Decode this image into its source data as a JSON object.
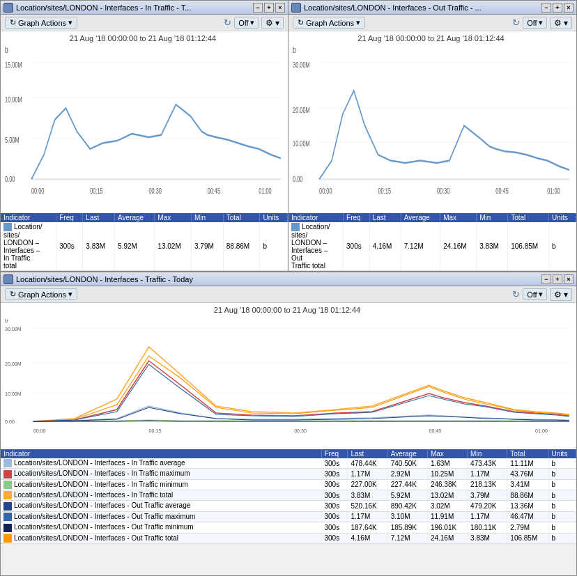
{
  "panels": {
    "top_left": {
      "title": "Location/sites/LONDON - Interfaces - In Traffic - T...",
      "time_range": "21 Aug '18 00:00:00 to 21 Aug '18 01:12:44",
      "y_label": "b",
      "y_ticks": [
        "15.00M",
        "10.00M",
        "5.00M",
        "0.00"
      ],
      "x_ticks": [
        "00:00",
        "00:15",
        "00:30",
        "00:45",
        "01:00"
      ],
      "graph_actions": "Graph Actions",
      "off_label": "Off",
      "table": {
        "headers": [
          "Indicator",
          "Freq",
          "Last",
          "Average",
          "Max",
          "Min",
          "Total",
          "Units"
        ],
        "rows": [
          {
            "color": "#6699cc",
            "name": "Location/\nsites/\nLONDON –\nInterfaces –\nIn Traffic\ntotal",
            "freq": "300s",
            "last": "3.83M",
            "average": "5.92M",
            "max": "13.02M",
            "min": "3.79M",
            "total": "88.86M",
            "units": "b"
          }
        ]
      }
    },
    "top_right": {
      "title": "Location/sites/LONDON - Interfaces - Out Traffic - ...",
      "time_range": "21 Aug '18 00:00:00 to 21 Aug '18 01:12:44",
      "y_label": "b",
      "y_ticks": [
        "30.00M",
        "20.00M",
        "10.00M",
        "0.00"
      ],
      "x_ticks": [
        "00:00",
        "00:15",
        "00:30",
        "00:45",
        "01:00"
      ],
      "graph_actions": "Graph Actions",
      "off_label": "Off",
      "table": {
        "headers": [
          "Indicator",
          "Freq",
          "Last",
          "Average",
          "Max",
          "Min",
          "Total",
          "Units"
        ],
        "rows": [
          {
            "color": "#6699cc",
            "name": "Location/\nsites/\nLONDON –\nInterfaces –\nOut\nTraffic total",
            "freq": "300s",
            "last": "4.16M",
            "average": "7.12M",
            "max": "24.16M",
            "min": "3.83M",
            "total": "106.85M",
            "units": "b"
          }
        ]
      }
    },
    "bottom": {
      "title": "Location/sites/LONDON - Interfaces - Traffic - Today",
      "time_range": "21 Aug '18 00:00:00 to 21 Aug '18 01:12:44",
      "y_label": "b",
      "y_ticks": [
        "30.00M",
        "20.00M",
        "10.00M",
        "0.00"
      ],
      "x_ticks": [
        "00:00",
        "00:15",
        "00:30",
        "00:45",
        "01:00"
      ],
      "graph_actions": "Graph Actions",
      "off_label": "Off",
      "table": {
        "headers": [
          "Indicator",
          "Freq",
          "Last",
          "Average",
          "Max",
          "Min",
          "Total",
          "Units"
        ],
        "rows": [
          {
            "color": "#99bbdd",
            "name": "Location/sites/LONDON - Interfaces - In Traffic average",
            "freq": "300s",
            "last": "478.44K",
            "average": "740.50K",
            "max": "1.63M",
            "min": "473.43K",
            "total": "11.11M",
            "units": "b"
          },
          {
            "color": "#cc4444",
            "name": "Location/sites/LONDON - Interfaces - In Traffic maximum",
            "freq": "300s",
            "last": "1.17M",
            "average": "2.92M",
            "max": "10.25M",
            "min": "1.17M",
            "total": "43.76M",
            "units": "b"
          },
          {
            "color": "#88cc88",
            "name": "Location/sites/LONDON - Interfaces - In Traffic minimum",
            "freq": "300s",
            "last": "227.00K",
            "average": "227.44K",
            "max": "246.38K",
            "min": "218.13K",
            "total": "3.41M",
            "units": "b"
          },
          {
            "color": "#ffaa33",
            "name": "Location/sites/LONDON - Interfaces - In Traffic total",
            "freq": "300s",
            "last": "3.83M",
            "average": "5.92M",
            "max": "13.02M",
            "min": "3.79M",
            "total": "88.86M",
            "units": "b"
          },
          {
            "color": "#224488",
            "name": "Location/sites/LONDON - Interfaces - Out Traffic average",
            "freq": "300s",
            "last": "520.16K",
            "average": "890.42K",
            "max": "3.02M",
            "min": "479.20K",
            "total": "13.36M",
            "units": "b"
          },
          {
            "color": "#3366aa",
            "name": "Location/sites/LONDON - Interfaces - Out Traffic maximum",
            "freq": "300s",
            "last": "1.17M",
            "average": "3.10M",
            "max": "11.91M",
            "min": "1.17M",
            "total": "46.47M",
            "units": "b"
          },
          {
            "color": "#112255",
            "name": "Location/sites/LONDON - Interfaces - Out Traffic minimum",
            "freq": "300s",
            "last": "187.64K",
            "average": "185.89K",
            "max": "196.01K",
            "min": "180.11K",
            "total": "2.79M",
            "units": "b"
          },
          {
            "color": "#ff9900",
            "name": "Location/sites/LONDON - Interfaces - Out Traffic total",
            "freq": "300s",
            "last": "4.16M",
            "average": "7.12M",
            "max": "24.16M",
            "min": "3.83M",
            "total": "106.85M",
            "units": "b"
          }
        ]
      }
    }
  },
  "labels": {
    "minimize": "−",
    "maximize": "+",
    "close": "×",
    "off": "Off",
    "graph_actions": "Graph Actions",
    "chevron": "▾",
    "refresh": "↻",
    "gear": "⚙"
  }
}
